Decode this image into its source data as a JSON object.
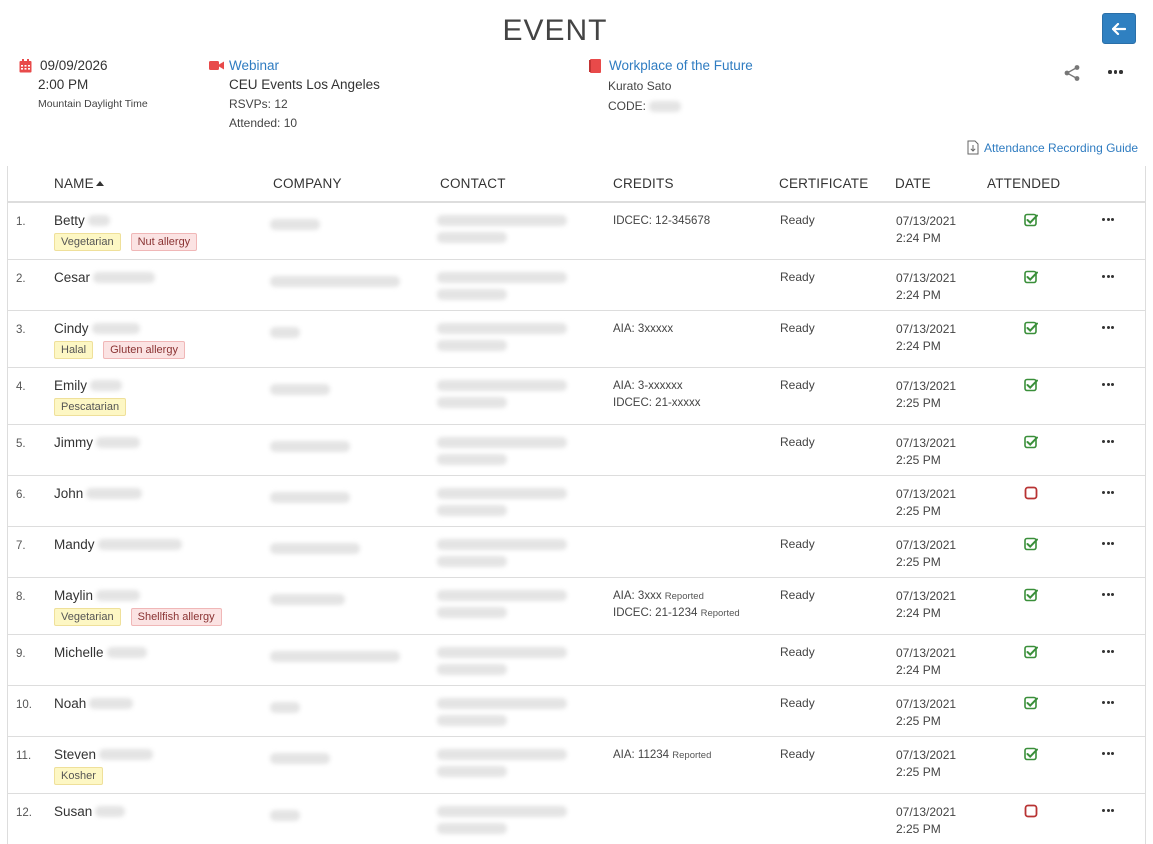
{
  "header": {
    "title": "EVENT",
    "back_icon": "arrow-left-icon",
    "colors": {
      "accent": "#2f80c1",
      "red": "#e84a4a",
      "green": "#3a8f3a"
    }
  },
  "event": {
    "date": "09/09/2026",
    "time": "2:00 PM",
    "timezone": "Mountain Daylight Time",
    "type_label": "Webinar",
    "organizer": "CEU Events Los Angeles",
    "rsvps": "RSVPs: 12",
    "attended": "Attended: 10",
    "course_title": "Workplace of the Future",
    "presenter": "Kurato Sato",
    "code_label": "CODE:"
  },
  "guide_link": "Attendance Recording Guide",
  "table": {
    "columns": [
      "NAME",
      "COMPANY",
      "CONTACT",
      "CREDITS",
      "CERTIFICATE",
      "DATE",
      "ATTENDED"
    ],
    "rows": [
      {
        "num": "1.",
        "first": "Betty",
        "tags": [
          {
            "label": "Vegetarian",
            "kind": "y"
          },
          {
            "label": "Nut allergy",
            "kind": "r"
          }
        ],
        "credits": [
          {
            "text": "IDCEC: 12-345678",
            "note": ""
          }
        ],
        "certificate": "Ready",
        "date": "07/13/2021",
        "time": "2:24 PM",
        "attended": true
      },
      {
        "num": "2.",
        "first": "Cesar",
        "tags": [],
        "credits": [],
        "certificate": "Ready",
        "date": "07/13/2021",
        "time": "2:24 PM",
        "attended": true
      },
      {
        "num": "3.",
        "first": "Cindy",
        "tags": [
          {
            "label": "Halal",
            "kind": "y"
          },
          {
            "label": "Gluten allergy",
            "kind": "r"
          }
        ],
        "credits": [
          {
            "text": "AIA: 3xxxxx",
            "note": ""
          }
        ],
        "certificate": "Ready",
        "date": "07/13/2021",
        "time": "2:24 PM",
        "attended": true
      },
      {
        "num": "4.",
        "first": "Emily",
        "tags": [
          {
            "label": "Pescatarian",
            "kind": "y"
          }
        ],
        "credits": [
          {
            "text": "AIA: 3-xxxxxx",
            "note": ""
          },
          {
            "text": "IDCEC: 21-xxxxx",
            "note": ""
          }
        ],
        "certificate": "Ready",
        "date": "07/13/2021",
        "time": "2:25 PM",
        "attended": true
      },
      {
        "num": "5.",
        "first": "Jimmy",
        "tags": [],
        "credits": [],
        "certificate": "Ready",
        "date": "07/13/2021",
        "time": "2:25 PM",
        "attended": true
      },
      {
        "num": "6.",
        "first": "John",
        "tags": [],
        "credits": [],
        "certificate": "",
        "date": "07/13/2021",
        "time": "2:25 PM",
        "attended": false
      },
      {
        "num": "7.",
        "first": "Mandy",
        "tags": [],
        "credits": [],
        "certificate": "Ready",
        "date": "07/13/2021",
        "time": "2:25 PM",
        "attended": true
      },
      {
        "num": "8.",
        "first": "Maylin",
        "tags": [
          {
            "label": "Vegetarian",
            "kind": "y"
          },
          {
            "label": "Shellfish allergy",
            "kind": "r"
          }
        ],
        "credits": [
          {
            "text": "AIA: 3xxx",
            "note": "Reported"
          },
          {
            "text": "IDCEC: 21-1234",
            "note": "Reported"
          }
        ],
        "certificate": "Ready",
        "date": "07/13/2021",
        "time": "2:24 PM",
        "attended": true
      },
      {
        "num": "9.",
        "first": "Michelle",
        "tags": [],
        "credits": [],
        "certificate": "Ready",
        "date": "07/13/2021",
        "time": "2:24 PM",
        "attended": true
      },
      {
        "num": "10.",
        "first": "Noah",
        "tags": [],
        "credits": [],
        "certificate": "Ready",
        "date": "07/13/2021",
        "time": "2:25 PM",
        "attended": true
      },
      {
        "num": "11.",
        "first": "Steven",
        "tags": [
          {
            "label": "Kosher",
            "kind": "y"
          }
        ],
        "credits": [
          {
            "text": "AIA: 11234",
            "note": "Reported"
          }
        ],
        "certificate": "Ready",
        "date": "07/13/2021",
        "time": "2:25 PM",
        "attended": true
      },
      {
        "num": "12.",
        "first": "Susan",
        "tags": [],
        "credits": [],
        "certificate": "",
        "date": "07/13/2021",
        "time": "2:25 PM",
        "attended": false
      }
    ]
  }
}
